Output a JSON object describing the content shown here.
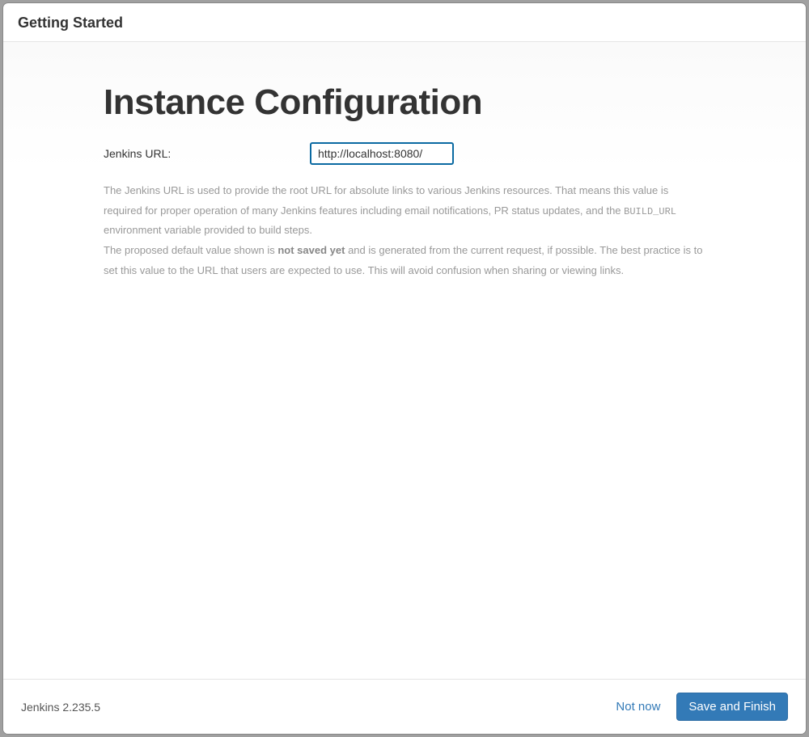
{
  "header": {
    "title": "Getting Started"
  },
  "page": {
    "heading": "Instance Configuration",
    "url_label": "Jenkins URL:",
    "url_value": "http://localhost:8080/",
    "desc_p1_before": "The Jenkins URL is used to provide the root URL for absolute links to various Jenkins resources. That means this value is required for proper operation of many Jenkins features including email notifications, PR status updates, and the ",
    "desc_p1_code": "BUILD_URL",
    "desc_p1_after": " environment variable provided to build steps.",
    "desc_p2_before": "The proposed default value shown is ",
    "desc_p2_bold": "not saved yet",
    "desc_p2_after": " and is generated from the current request, if possible. The best practice is to set this value to the URL that users are expected to use. This will avoid confusion when sharing or viewing links."
  },
  "footer": {
    "version": "Jenkins 2.235.5",
    "not_now_label": "Not now",
    "save_label": "Save and Finish"
  }
}
